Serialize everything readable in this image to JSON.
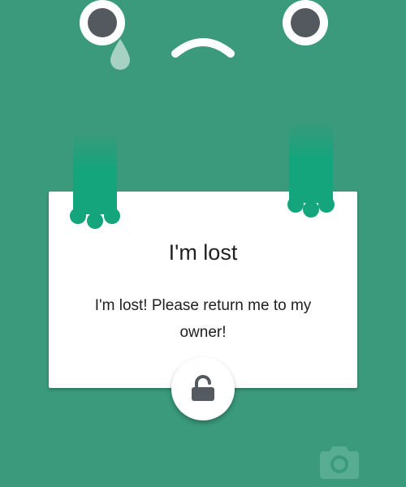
{
  "card": {
    "title": "I'm lost",
    "message": "I'm lost! Please return me to my owner!"
  },
  "icons": {
    "unlock": "unlock-icon",
    "camera": "camera-icon"
  },
  "colors": {
    "background": "#3a9a7b",
    "paw_green": "#14a57c",
    "card_white": "#ffffff",
    "icon_gray": "#555a60",
    "text": "#202020"
  }
}
